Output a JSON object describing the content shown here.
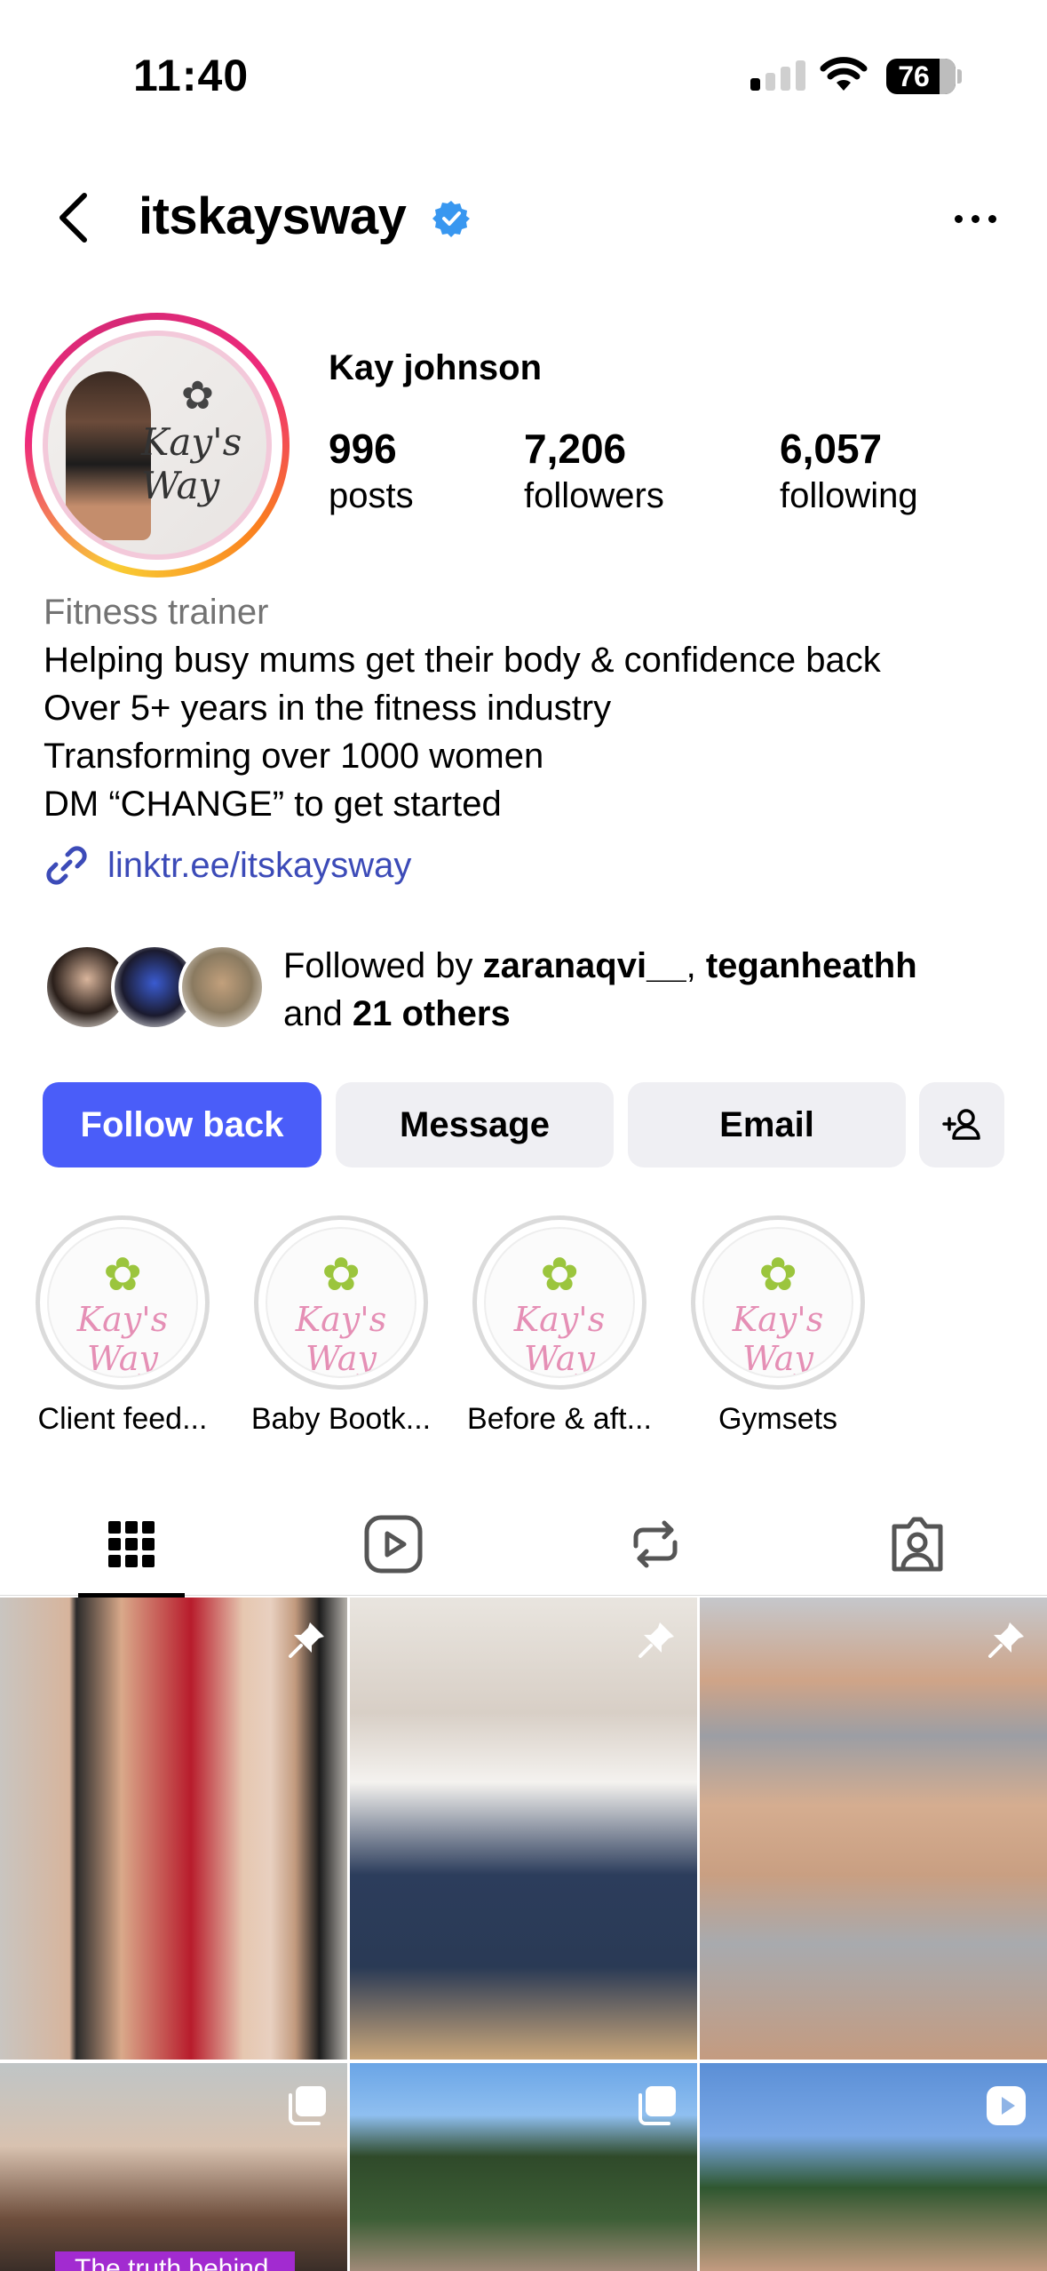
{
  "status_bar": {
    "time": "11:40",
    "battery": "76",
    "signal_bars_active": 1,
    "signal_bars_total": 4
  },
  "header": {
    "username": "itskaysway",
    "verified": true
  },
  "profile": {
    "display_name": "Kay johnson",
    "stats": [
      {
        "value": "996",
        "label": "posts"
      },
      {
        "value": "7,206",
        "label": "followers"
      },
      {
        "value": "6,057",
        "label": "following"
      }
    ],
    "category": "Fitness trainer",
    "bio_lines": [
      "Helping busy mums get their body & confidence back",
      "Over 5+ years in the fitness industry",
      "Transforming over 1000 women",
      "DM “CHANGE” to get started"
    ],
    "link": "linktr.ee/itskaysway",
    "followed_by": {
      "prefix": "Followed by ",
      "user1": "zaranaqvi__",
      "sep": ", ",
      "user2": "teganheathh",
      "and": "and ",
      "others": "21 others"
    },
    "avatar_logo_text": "Kay's Way"
  },
  "buttons": {
    "follow_back": "Follow back",
    "message": "Message",
    "email": "Email"
  },
  "highlights": [
    {
      "label": "Client feed...",
      "logo_text": "Kay's Way"
    },
    {
      "label": "Baby Bootk...",
      "logo_text": "Kay's Way"
    },
    {
      "label": "Before & aft...",
      "logo_text": "Kay's Way"
    },
    {
      "label": "Gymsets",
      "logo_text": "Kay's Way"
    }
  ],
  "tabs": [
    "grid-tab",
    "reels-tab",
    "reposts-tab",
    "tagged-tab"
  ],
  "posts": [
    {
      "type": "pinned"
    },
    {
      "type": "pinned"
    },
    {
      "type": "pinned"
    },
    {
      "type": "carousel",
      "caption": "The truth behind"
    },
    {
      "type": "carousel"
    },
    {
      "type": "reel"
    }
  ],
  "colors": {
    "accent": "#4a5df9",
    "link": "#3c4bb8",
    "verified": "#3897f0",
    "secondary_text": "#737373"
  }
}
